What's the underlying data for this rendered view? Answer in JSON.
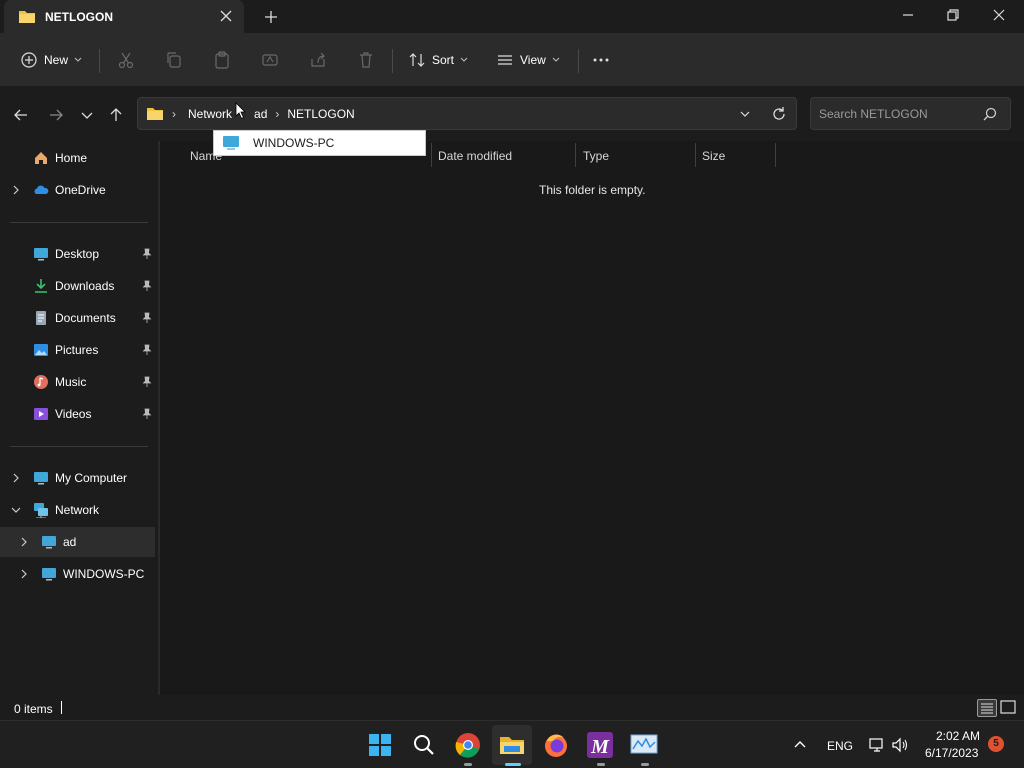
{
  "window": {
    "tab_title": "NETLOGON",
    "new_tab_icon": "plus-icon"
  },
  "toolbar": {
    "new_label": "New",
    "sort_label": "Sort",
    "view_label": "View",
    "icons": [
      "cut-icon",
      "copy-icon",
      "paste-icon",
      "rename-icon",
      "share-icon",
      "delete-icon",
      "more-icon"
    ]
  },
  "address": {
    "crumbs": [
      "Network",
      "ad",
      "NETLOGON"
    ]
  },
  "search": {
    "placeholder": "Search NETLOGON"
  },
  "sidebar": {
    "items": [
      {
        "label": "Home",
        "icon": "home-icon"
      },
      {
        "label": "OneDrive",
        "icon": "onedrive-icon"
      },
      {
        "label": "Desktop",
        "icon": "desktop-icon"
      },
      {
        "label": "Downloads",
        "icon": "downloads-icon"
      },
      {
        "label": "Documents",
        "icon": "documents-icon"
      },
      {
        "label": "Pictures",
        "icon": "pictures-icon"
      },
      {
        "label": "Music",
        "icon": "music-icon"
      },
      {
        "label": "Videos",
        "icon": "videos-icon"
      },
      {
        "label": "My Computer",
        "icon": "computer-icon"
      },
      {
        "label": "Network",
        "icon": "network-icon"
      },
      {
        "label": "ad",
        "icon": "computer-icon"
      },
      {
        "label": "WINDOWS-PC",
        "icon": "computer-icon"
      }
    ]
  },
  "content": {
    "columns": [
      "Name",
      "Date modified",
      "Type",
      "Size"
    ],
    "empty_message": "This folder is empty."
  },
  "suggestion": {
    "label": "WINDOWS-PC"
  },
  "status": {
    "item_count": "0 items"
  },
  "taskbar": {
    "apps": [
      "start-icon",
      "search-icon",
      "chrome-icon",
      "file-explorer-icon",
      "firefox-icon",
      "m-app-icon",
      "network-monitor-icon"
    ],
    "language": "ENG",
    "time": "2:02 AM",
    "date": "6/17/2023",
    "notification_count": "5"
  },
  "colors": {
    "accent": "#60cdff",
    "folder": "#f0c33c",
    "badge": "#e0522f"
  }
}
